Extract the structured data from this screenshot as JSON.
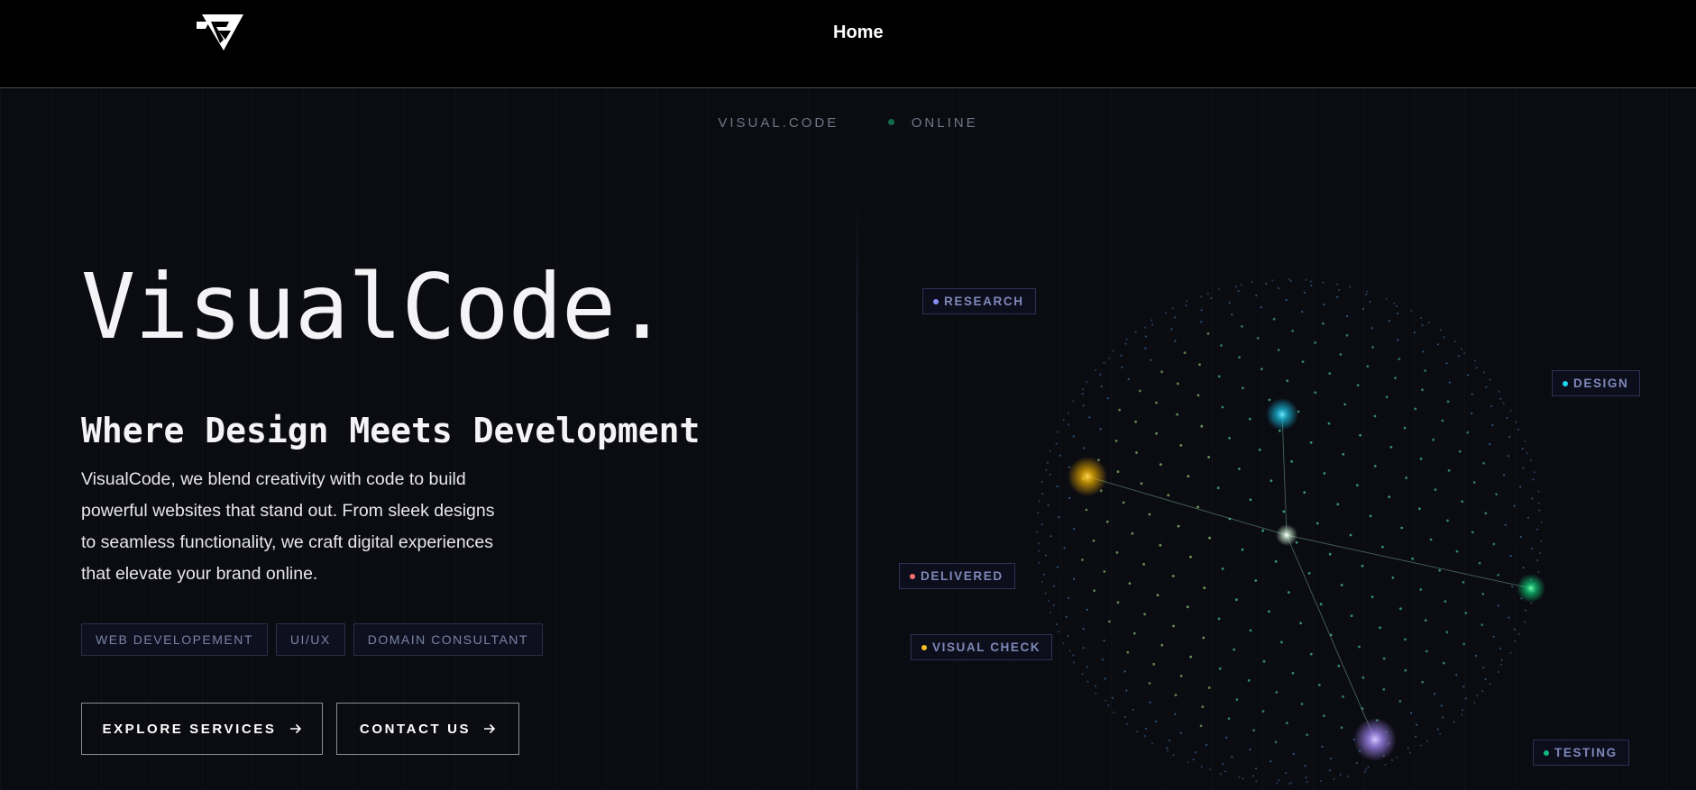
{
  "nav": {
    "home_label": "Home"
  },
  "status": {
    "brand": "VISUAL.CODE",
    "online": "ONLINE",
    "online_color": "#10b981"
  },
  "hero": {
    "title": "VisualCode.",
    "subtitle": "Where Design Meets Development",
    "description": "VisualCode, we blend creativity with code to build powerful websites that stand out. From sleek designs to seamless functionality, we craft digital experiences that elevate your brand online.",
    "tags": [
      "WEB DEVELOPEMENT",
      "UI/UX",
      "DOMAIN CONSULTANT"
    ],
    "buttons": {
      "explore": "EXPLORE SERVICES",
      "contact": "CONTACT US",
      "arrow_icon": "arrow-right-icon"
    }
  },
  "orbit": {
    "labels": {
      "research": "RESEARCH",
      "design": "DESIGN",
      "delivered": "DELIVERED",
      "visual_check": "VISUAL CHECK",
      "testing": "TESTING"
    },
    "colors": {
      "research": "#8b8cf6",
      "design": "#22d3ee",
      "delivered": "#f87171",
      "visual_check": "#fbbf24",
      "testing": "#10b981",
      "node_yellow": "#f5b400",
      "node_cyan": "#19c3e6",
      "node_green": "#10d07a",
      "node_purple": "#a78bfa",
      "node_center": "#e8ffe8"
    }
  },
  "accent_color": "#7a83a4"
}
